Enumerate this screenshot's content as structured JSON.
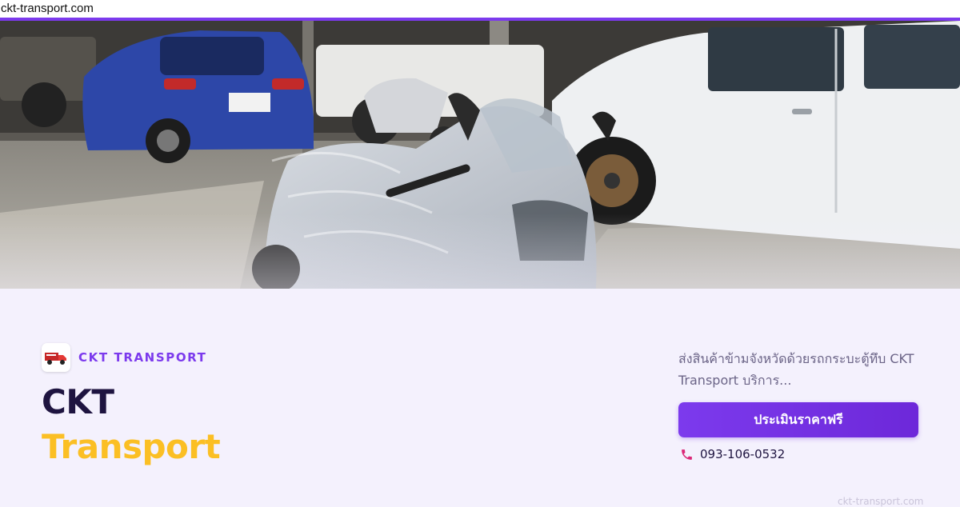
{
  "browser": {
    "url": "ckt-transport.com"
  },
  "theme": {
    "accent": "#7c3aed",
    "title_dark": "#1e1440",
    "title_highlight": "#fbbf24",
    "phone_icon_color": "#db2777",
    "background": "#f4f1fd"
  },
  "hero": {
    "image": "photo of wrapped white motorcycle, white pickup truck and blue hatchback in a garage"
  },
  "brand": {
    "logo_icon": "truck-logo-icon",
    "name": "CKT TRANSPORT"
  },
  "title": {
    "line1": "CKT",
    "line2": "Transport"
  },
  "description": "ส่งสินค้าข้ามจังหวัดด้วยรถกระบะตู้ทึบ CKT Transport บริการ...",
  "cta": {
    "label": "ประเมินราคาฟรี"
  },
  "contact": {
    "phone_icon": "phone-icon",
    "phone": "093-106-0532"
  },
  "footer": {
    "domain": "ckt-transport.com"
  }
}
